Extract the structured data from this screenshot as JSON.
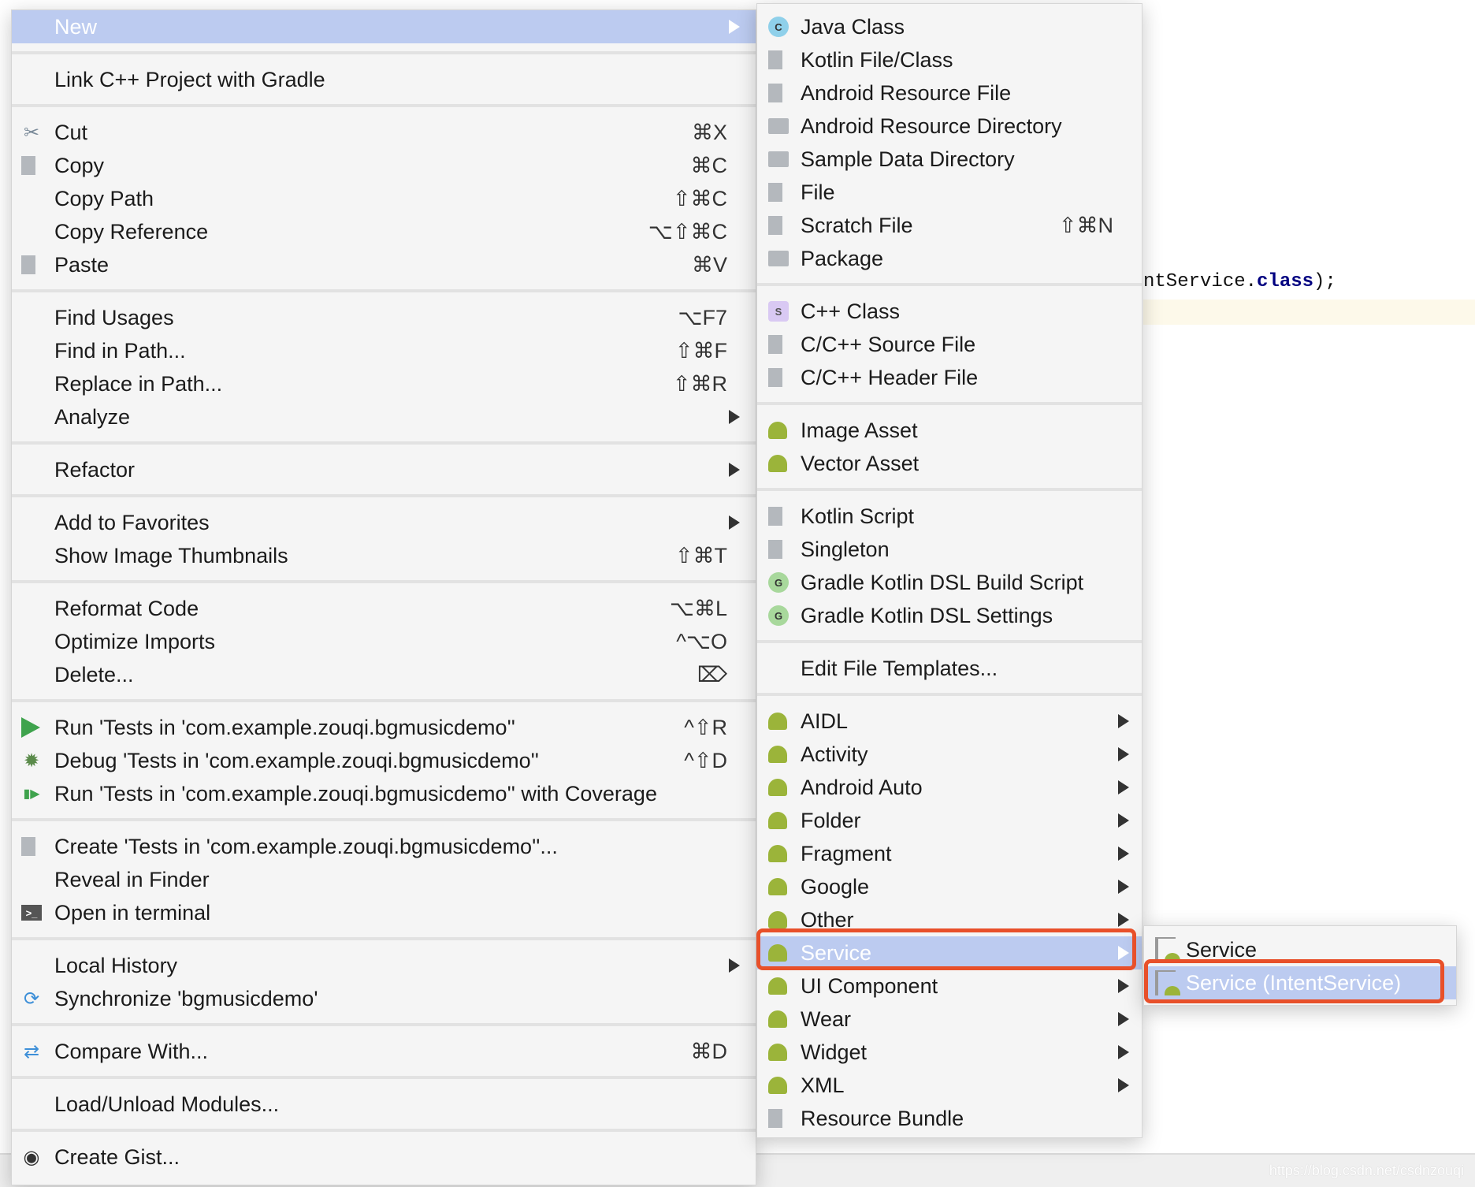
{
  "editor": {
    "visible_code_line": "ntService.",
    "visible_code_keyword": "class",
    "visible_code_end": ");"
  },
  "watermark": "https://blog.csdn.net/csdnzouqi",
  "colors": {
    "highlight": "#bccbf0",
    "annotation_outline": "#e8502a",
    "android_green": "#9bb43a"
  },
  "main_menu": [
    {
      "label": "New",
      "submenu": true,
      "highlighted": true
    },
    {
      "separator": true
    },
    {
      "label": "Link C++ Project with Gradle"
    },
    {
      "separator": true
    },
    {
      "label": "Cut",
      "shortcut": "⌘X",
      "icon": "scissors-icon"
    },
    {
      "label": "Copy",
      "shortcut": "⌘C",
      "icon": "copy-icon"
    },
    {
      "label": "Copy Path",
      "shortcut": "⇧⌘C"
    },
    {
      "label": "Copy Reference",
      "shortcut": "⌥⇧⌘C"
    },
    {
      "label": "Paste",
      "shortcut": "⌘V",
      "icon": "paste-icon"
    },
    {
      "separator": true
    },
    {
      "label": "Find Usages",
      "shortcut": "⌥F7"
    },
    {
      "label": "Find in Path...",
      "shortcut": "⇧⌘F"
    },
    {
      "label": "Replace in Path...",
      "shortcut": "⇧⌘R"
    },
    {
      "label": "Analyze",
      "submenu": true
    },
    {
      "separator": true
    },
    {
      "label": "Refactor",
      "submenu": true
    },
    {
      "separator": true
    },
    {
      "label": "Add to Favorites",
      "submenu": true
    },
    {
      "label": "Show Image Thumbnails",
      "shortcut": "⇧⌘T"
    },
    {
      "separator": true
    },
    {
      "label": "Reformat Code",
      "shortcut": "⌥⌘L"
    },
    {
      "label": "Optimize Imports",
      "shortcut": "^⌥O"
    },
    {
      "label": "Delete...",
      "shortcut": "⌦"
    },
    {
      "separator": true
    },
    {
      "label": "Run 'Tests in 'com.example.zouqi.bgmusicdemo''",
      "shortcut": "^⇧R",
      "icon": "run-icon"
    },
    {
      "label": "Debug 'Tests in 'com.example.zouqi.bgmusicdemo''",
      "shortcut": "^⇧D",
      "icon": "debug-icon"
    },
    {
      "label": "Run 'Tests in 'com.example.zouqi.bgmusicdemo'' with Coverage",
      "icon": "coverage-icon"
    },
    {
      "separator": true
    },
    {
      "label": "Create 'Tests in 'com.example.zouqi.bgmusicdemo''...",
      "icon": "create-test-icon"
    },
    {
      "label": "Reveal in Finder"
    },
    {
      "label": "Open in terminal",
      "icon": "terminal-icon"
    },
    {
      "separator": true
    },
    {
      "label": "Local History",
      "submenu": true
    },
    {
      "label": "Synchronize 'bgmusicdemo'",
      "icon": "sync-icon"
    },
    {
      "separator": true
    },
    {
      "label": "Compare With...",
      "shortcut": "⌘D",
      "icon": "compare-icon"
    },
    {
      "separator": true
    },
    {
      "label": "Load/Unload Modules..."
    },
    {
      "separator": true
    },
    {
      "label": "Create Gist...",
      "icon": "github-icon"
    }
  ],
  "new_menu": [
    {
      "label": "Java Class",
      "icon": "java-class-icon",
      "badge": "C",
      "badge_color": "#8fd0ea"
    },
    {
      "label": "Kotlin File/Class",
      "icon": "kotlin-file-icon"
    },
    {
      "label": "Android Resource File",
      "icon": "android-resource-file-icon"
    },
    {
      "label": "Android Resource Directory",
      "icon": "folder-icon"
    },
    {
      "label": "Sample Data Directory",
      "icon": "folder-icon"
    },
    {
      "label": "File",
      "icon": "file-icon"
    },
    {
      "label": "Scratch File",
      "shortcut": "⇧⌘N",
      "icon": "scratch-file-icon"
    },
    {
      "label": "Package",
      "icon": "package-icon"
    },
    {
      "separator": true
    },
    {
      "label": "C++ Class",
      "icon": "cpp-class-icon",
      "badge": "S"
    },
    {
      "label": "C/C++ Source File",
      "icon": "cpp-source-icon"
    },
    {
      "label": "C/C++ Header File",
      "icon": "cpp-header-icon"
    },
    {
      "separator": true
    },
    {
      "label": "Image Asset",
      "icon": "android-icon"
    },
    {
      "label": "Vector Asset",
      "icon": "android-icon"
    },
    {
      "separator": true
    },
    {
      "label": "Kotlin Script",
      "icon": "kotlin-script-icon"
    },
    {
      "label": "Singleton",
      "icon": "singleton-icon"
    },
    {
      "label": "Gradle Kotlin DSL Build Script",
      "icon": "gradle-icon",
      "badge": "G",
      "badge_color": "#a8d89c"
    },
    {
      "label": "Gradle Kotlin DSL Settings",
      "icon": "gradle-icon",
      "badge": "G",
      "badge_color": "#a8d89c"
    },
    {
      "separator": true
    },
    {
      "label": "Edit File Templates..."
    },
    {
      "separator": true
    },
    {
      "label": "AIDL",
      "icon": "android-icon",
      "submenu": true
    },
    {
      "label": "Activity",
      "icon": "android-icon",
      "submenu": true
    },
    {
      "label": "Android Auto",
      "icon": "android-icon",
      "submenu": true
    },
    {
      "label": "Folder",
      "icon": "android-icon",
      "submenu": true
    },
    {
      "label": "Fragment",
      "icon": "android-icon",
      "submenu": true
    },
    {
      "label": "Google",
      "icon": "android-icon",
      "submenu": true
    },
    {
      "label": "Other",
      "icon": "android-icon",
      "submenu": true
    },
    {
      "label": "Service",
      "icon": "android-icon",
      "submenu": true,
      "highlighted": true
    },
    {
      "label": "UI Component",
      "icon": "android-icon",
      "submenu": true
    },
    {
      "label": "Wear",
      "icon": "android-icon",
      "submenu": true
    },
    {
      "label": "Widget",
      "icon": "android-icon",
      "submenu": true
    },
    {
      "label": "XML",
      "icon": "android-icon",
      "submenu": true
    },
    {
      "label": "Resource Bundle",
      "icon": "resource-bundle-icon"
    }
  ],
  "service_menu": [
    {
      "label": "Service",
      "icon": "android-file-icon"
    },
    {
      "label": "Service (IntentService)",
      "icon": "android-file-icon",
      "highlighted": true
    }
  ]
}
